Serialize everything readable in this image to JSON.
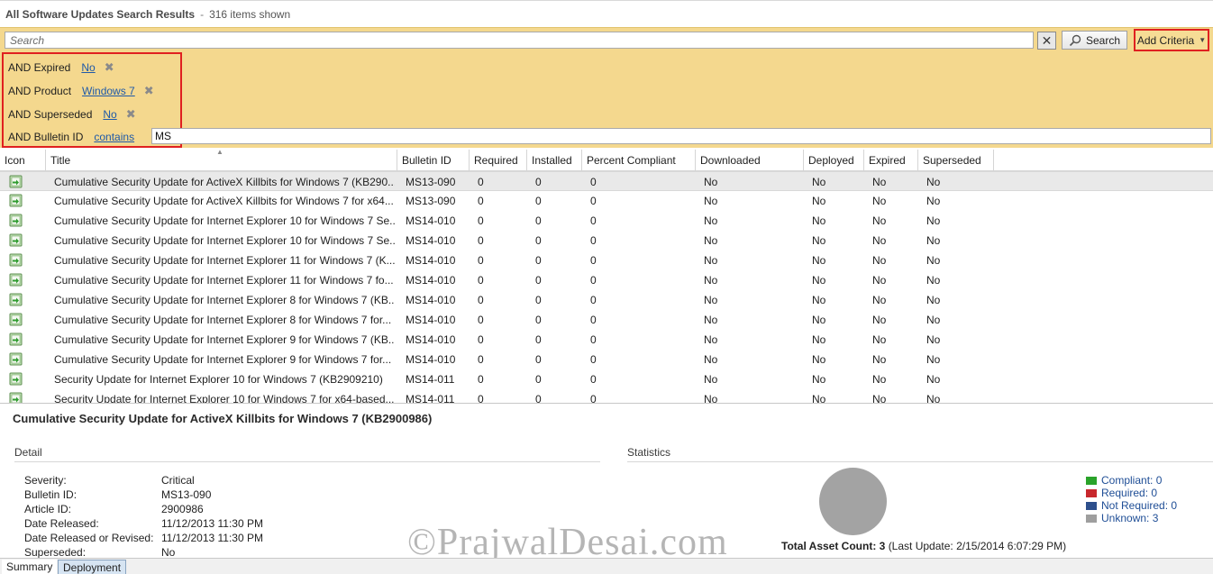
{
  "header": {
    "title": "All Software Updates Search Results",
    "separator": "-",
    "count": "316 items shown"
  },
  "search": {
    "placeholder": "Search",
    "clear_label": "✕",
    "button_label": "Search",
    "add_criteria_label": "Add Criteria"
  },
  "criteria": [
    {
      "label": "AND Expired",
      "value": "No"
    },
    {
      "label": "AND Product",
      "value": "Windows 7"
    },
    {
      "label": "AND Superseded",
      "value": "No"
    },
    {
      "label": "AND Bulletin ID",
      "value": "contains",
      "text": "MS"
    }
  ],
  "grid": {
    "columns": [
      "Icon",
      "Title",
      "Bulletin ID",
      "Required",
      "Installed",
      "Percent Compliant",
      "Downloaded",
      "Deployed",
      "Expired",
      "Superseded"
    ],
    "rows": [
      [
        "Cumulative Security Update for ActiveX Killbits for Windows 7 (KB290...",
        "MS13-090",
        "0",
        "0",
        "0",
        "No",
        "No",
        "No",
        "No"
      ],
      [
        "Cumulative Security Update for ActiveX Killbits for Windows 7 for x64...",
        "MS13-090",
        "0",
        "0",
        "0",
        "No",
        "No",
        "No",
        "No"
      ],
      [
        "Cumulative Security Update for Internet Explorer 10 for Windows 7 Se...",
        "MS14-010",
        "0",
        "0",
        "0",
        "No",
        "No",
        "No",
        "No"
      ],
      [
        "Cumulative Security Update for Internet Explorer 10 for Windows 7 Se...",
        "MS14-010",
        "0",
        "0",
        "0",
        "No",
        "No",
        "No",
        "No"
      ],
      [
        "Cumulative Security Update for Internet Explorer 11 for Windows 7 (K...",
        "MS14-010",
        "0",
        "0",
        "0",
        "No",
        "No",
        "No",
        "No"
      ],
      [
        "Cumulative Security Update for Internet Explorer 11 for Windows 7 fo...",
        "MS14-010",
        "0",
        "0",
        "0",
        "No",
        "No",
        "No",
        "No"
      ],
      [
        "Cumulative Security Update for Internet Explorer 8 for Windows 7 (KB...",
        "MS14-010",
        "0",
        "0",
        "0",
        "No",
        "No",
        "No",
        "No"
      ],
      [
        "Cumulative Security Update for Internet Explorer 8 for Windows 7 for...",
        "MS14-010",
        "0",
        "0",
        "0",
        "No",
        "No",
        "No",
        "No"
      ],
      [
        "Cumulative Security Update for Internet Explorer 9 for Windows 7 (KB...",
        "MS14-010",
        "0",
        "0",
        "0",
        "No",
        "No",
        "No",
        "No"
      ],
      [
        "Cumulative Security Update for Internet Explorer 9 for Windows 7 for...",
        "MS14-010",
        "0",
        "0",
        "0",
        "No",
        "No",
        "No",
        "No"
      ],
      [
        "Security Update for Internet Explorer 10 for Windows 7 (KB2909210)",
        "MS14-011",
        "0",
        "0",
        "0",
        "No",
        "No",
        "No",
        "No"
      ],
      [
        "Security Update for Internet Explorer 10 for Windows 7 for x64-based...",
        "MS14-011",
        "0",
        "0",
        "0",
        "No",
        "No",
        "No",
        "No"
      ]
    ]
  },
  "details": {
    "title": "Cumulative Security Update for ActiveX Killbits for Windows 7 (KB2900986)",
    "detail_heading": "Detail",
    "statistics_heading": "Statistics",
    "fields": [
      {
        "label": "Severity:",
        "value": "Critical"
      },
      {
        "label": "Bulletin ID:",
        "value": "MS13-090"
      },
      {
        "label": "Article ID:",
        "value": "2900986"
      },
      {
        "label": "Date Released:",
        "value": "11/12/2013 11:30 PM"
      },
      {
        "label": "Date Released or Revised:",
        "value": "11/12/2013 11:30 PM"
      },
      {
        "label": "Superseded:",
        "value": "No"
      }
    ],
    "legend": [
      {
        "label": "Compliant: 0",
        "color": "#2aa32a"
      },
      {
        "label": "Required: 0",
        "color": "#c8282d"
      },
      {
        "label": "Not Required: 0",
        "color": "#2d4f8c"
      },
      {
        "label": "Unknown: 3",
        "color": "#9e9e9e"
      }
    ],
    "asset_count_label": "Total Asset Count: 3",
    "last_update": "(Last Update: 2/15/2014 6:07:29 PM)"
  },
  "watermark": "©PrajwalDesai.com",
  "tabs": [
    "Summary",
    "Deployment"
  ]
}
